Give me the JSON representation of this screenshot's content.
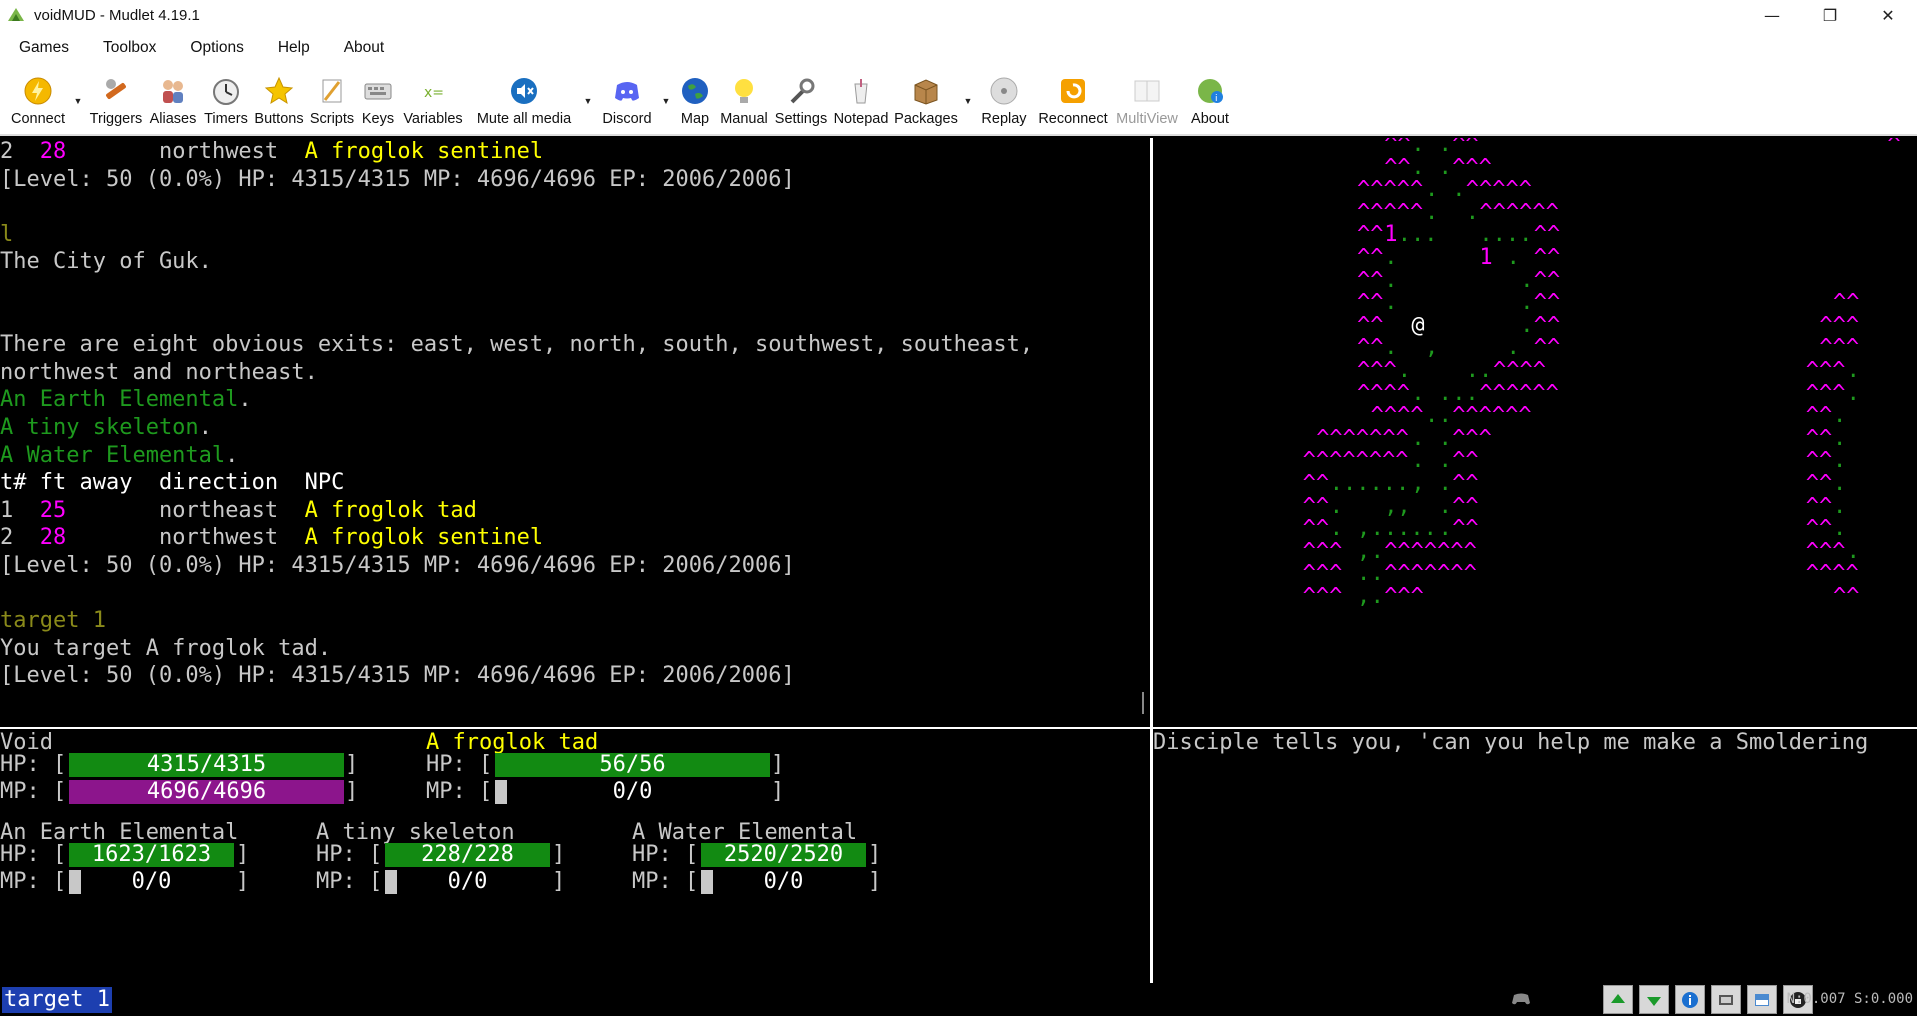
{
  "window": {
    "title": "voidMUD - Mudlet 4.19.1",
    "minimize": "—",
    "maximize": "❐",
    "close": "✕"
  },
  "menu": [
    "Games",
    "Toolbox",
    "Options",
    "Help",
    "About"
  ],
  "toolbar": [
    {
      "label": "Connect",
      "icon": "connect-icon",
      "dropdown": true
    },
    {
      "label": "Triggers",
      "icon": "triggers-icon"
    },
    {
      "label": "Aliases",
      "icon": "aliases-icon"
    },
    {
      "label": "Timers",
      "icon": "timers-icon"
    },
    {
      "label": "Buttons",
      "icon": "buttons-icon"
    },
    {
      "label": "Scripts",
      "icon": "scripts-icon"
    },
    {
      "label": "Keys",
      "icon": "keys-icon"
    },
    {
      "label": "Variables",
      "icon": "variables-icon"
    },
    {
      "label": "Mute all media",
      "icon": "mute-icon",
      "dropdown": true
    },
    {
      "label": "Discord",
      "icon": "discord-icon",
      "dropdown": true
    },
    {
      "label": "Map",
      "icon": "map-icon"
    },
    {
      "label": "Manual",
      "icon": "manual-icon"
    },
    {
      "label": "Settings",
      "icon": "settings-icon"
    },
    {
      "label": "Notepad",
      "icon": "notepad-icon"
    },
    {
      "label": "Packages",
      "icon": "packages-icon",
      "dropdown": true
    },
    {
      "label": "Replay",
      "icon": "replay-icon"
    },
    {
      "label": "Reconnect",
      "icon": "reconnect-icon"
    },
    {
      "label": "MultiView",
      "icon": "multiview-icon",
      "disabled": true
    },
    {
      "label": "About",
      "icon": "about-icon"
    }
  ],
  "console": {
    "lines": [
      {
        "segs": [
          [
            "w",
            "2  "
          ],
          [
            "m",
            "28"
          ],
          [
            "w",
            "       northwest  "
          ],
          [
            "y",
            "A froglok sentinel"
          ]
        ]
      },
      {
        "segs": [
          [
            "w",
            "[Level: 50 (0.0%) HP: 4315/4315 MP: 4696/4696 EP: 2006/2006]"
          ]
        ]
      },
      {
        "segs": [
          [
            "w",
            ""
          ]
        ]
      },
      {
        "segs": [
          [
            "ol",
            "l"
          ]
        ]
      },
      {
        "segs": [
          [
            "w",
            "The City of Guk."
          ]
        ]
      },
      {
        "segs": [
          [
            "w",
            ""
          ]
        ]
      },
      {
        "segs": [
          [
            "w",
            ""
          ]
        ]
      },
      {
        "segs": [
          [
            "w",
            "There are eight obvious exits: east, west, north, south, southwest, southeast,"
          ]
        ]
      },
      {
        "segs": [
          [
            "w",
            "northwest and northeast."
          ]
        ]
      },
      {
        "segs": [
          [
            "g",
            "An Earth Elemental"
          ],
          [
            "w",
            "."
          ]
        ]
      },
      {
        "segs": [
          [
            "g",
            "A tiny skeleton"
          ],
          [
            "w",
            "."
          ]
        ]
      },
      {
        "segs": [
          [
            "g",
            "A Water Elemental"
          ],
          [
            "w",
            "."
          ]
        ]
      },
      {
        "segs": [
          [
            "wb",
            "t# ft away  direction  NPC"
          ]
        ]
      },
      {
        "segs": [
          [
            "w",
            "1  "
          ],
          [
            "m",
            "25"
          ],
          [
            "w",
            "       northeast  "
          ],
          [
            "y",
            "A froglok tad"
          ]
        ]
      },
      {
        "segs": [
          [
            "w",
            "2  "
          ],
          [
            "m",
            "28"
          ],
          [
            "w",
            "       northwest  "
          ],
          [
            "y",
            "A froglok sentinel"
          ]
        ]
      },
      {
        "segs": [
          [
            "w",
            "[Level: 50 (0.0%) HP: 4315/4315 MP: 4696/4696 EP: 2006/2006]"
          ]
        ]
      },
      {
        "segs": [
          [
            "w",
            ""
          ]
        ]
      },
      {
        "segs": [
          [
            "ol",
            "target 1"
          ]
        ]
      },
      {
        "segs": [
          [
            "w",
            "You target A froglok tad."
          ]
        ]
      },
      {
        "segs": [
          [
            "w",
            "[Level: 50 (0.0%) HP: 4315/4315 MP: 4696/4696 EP: 2006/2006]"
          ]
        ]
      }
    ]
  },
  "map": {
    "rows": [
      [
        [
          17,
          "m",
          "^^"
        ],
        [
          19,
          "g",
          "."
        ],
        [
          20,
          "w",
          " "
        ],
        [
          21,
          "g",
          "."
        ],
        [
          22,
          "m",
          "^^"
        ],
        [
          54,
          "m",
          "^"
        ]
      ],
      [
        [
          17,
          "m",
          "^^"
        ],
        [
          19,
          "g",
          "."
        ],
        [
          21,
          "g",
          "."
        ],
        [
          22,
          "m",
          "^^^"
        ]
      ],
      [
        [
          15,
          "m",
          "^^^^^"
        ],
        [
          20,
          "g",
          "."
        ],
        [
          22,
          "g",
          "."
        ],
        [
          23,
          "m",
          "^^^^^"
        ]
      ],
      [
        [
          15,
          "m",
          "^^^^^"
        ],
        [
          20,
          "g",
          "."
        ],
        [
          23,
          "g",
          "."
        ],
        [
          24,
          "m",
          "^^^^^^"
        ]
      ],
      [
        [
          15,
          "m",
          "^^"
        ],
        [
          17,
          "m",
          "1"
        ],
        [
          18,
          "g",
          "..."
        ],
        [
          24,
          "g",
          "...."
        ],
        [
          28,
          "m",
          "^^"
        ]
      ],
      [
        [
          15,
          "m",
          "^^"
        ],
        [
          17,
          "g",
          "."
        ],
        [
          24,
          "m",
          "1"
        ],
        [
          26,
          "g",
          "."
        ],
        [
          28,
          "m",
          "^^"
        ]
      ],
      [
        [
          15,
          "m",
          "^^"
        ],
        [
          17,
          "g",
          "."
        ],
        [
          27,
          "g",
          "."
        ],
        [
          28,
          "m",
          "^^"
        ]
      ],
      [
        [
          15,
          "m",
          "^^"
        ],
        [
          17,
          "g",
          "."
        ],
        [
          27,
          "g",
          "."
        ],
        [
          28,
          "m",
          "^^"
        ],
        [
          50,
          "m",
          "^^"
        ]
      ],
      [
        [
          15,
          "m",
          "^^"
        ],
        [
          19,
          "wb",
          "@"
        ],
        [
          27,
          "g",
          "."
        ],
        [
          28,
          "m",
          "^^"
        ],
        [
          49,
          "m",
          "^^^"
        ]
      ],
      [
        [
          15,
          "m",
          "^^"
        ],
        [
          17,
          "g",
          "."
        ],
        [
          20,
          "g",
          ","
        ],
        [
          26,
          "g",
          "."
        ],
        [
          28,
          "m",
          "^^"
        ],
        [
          49,
          "m",
          "^^^"
        ]
      ],
      [
        [
          15,
          "m",
          "^^^"
        ],
        [
          18,
          "g",
          "."
        ],
        [
          23,
          "g",
          ".."
        ],
        [
          25,
          "m",
          "^^^^"
        ],
        [
          48,
          "m",
          "^^^"
        ],
        [
          51,
          "g",
          "."
        ]
      ],
      [
        [
          15,
          "m",
          "^^^^"
        ],
        [
          19,
          "g",
          "."
        ],
        [
          21,
          "g",
          "."
        ],
        [
          22,
          "g",
          ".."
        ],
        [
          24,
          "m",
          "^^^^^^"
        ],
        [
          48,
          "m",
          "^^^"
        ],
        [
          51,
          "g",
          "."
        ]
      ],
      [
        [
          16,
          "m",
          "^^^^"
        ],
        [
          20,
          "g",
          "."
        ],
        [
          21,
          "g",
          "."
        ],
        [
          22,
          "m",
          "^^^^^^"
        ],
        [
          48,
          "m",
          "^^"
        ],
        [
          50,
          "g",
          "."
        ]
      ],
      [
        [
          12,
          "m",
          "^^^^^^^"
        ],
        [
          19,
          "g",
          "."
        ],
        [
          21,
          "g",
          "."
        ],
        [
          22,
          "m",
          "^^^"
        ],
        [
          48,
          "m",
          "^^"
        ],
        [
          50,
          "g",
          "."
        ]
      ],
      [
        [
          11,
          "m",
          "^^^^^^^^"
        ],
        [
          19,
          "g",
          "."
        ],
        [
          21,
          "g",
          "."
        ],
        [
          22,
          "m",
          "^^"
        ],
        [
          48,
          "m",
          "^^"
        ],
        [
          50,
          "g",
          "."
        ]
      ],
      [
        [
          11,
          "m",
          "^^"
        ],
        [
          13,
          "g",
          "......"
        ],
        [
          19,
          "g",
          ","
        ],
        [
          21,
          "g",
          "."
        ],
        [
          22,
          "m",
          "^^"
        ],
        [
          48,
          "m",
          "^^"
        ],
        [
          50,
          "g",
          "."
        ]
      ],
      [
        [
          11,
          "m",
          "^^"
        ],
        [
          13,
          "g",
          "."
        ],
        [
          17,
          "g",
          ",,"
        ],
        [
          21,
          "g",
          "."
        ],
        [
          22,
          "m",
          "^^"
        ],
        [
          48,
          "m",
          "^^"
        ],
        [
          50,
          "g",
          "."
        ]
      ],
      [
        [
          11,
          "m",
          "^^"
        ],
        [
          13,
          "g",
          "."
        ],
        [
          15,
          "g",
          ","
        ],
        [
          16,
          "g",
          "....."
        ],
        [
          21,
          "g",
          "."
        ],
        [
          22,
          "m",
          "^^"
        ],
        [
          48,
          "m",
          "^^"
        ],
        [
          50,
          "g",
          "."
        ]
      ],
      [
        [
          11,
          "m",
          "^^^"
        ],
        [
          15,
          "g",
          ","
        ],
        [
          16,
          "g",
          "."
        ],
        [
          17,
          "m",
          "^^^^^^^"
        ],
        [
          48,
          "m",
          "^^^"
        ],
        [
          51,
          "g",
          "."
        ]
      ],
      [
        [
          11,
          "m",
          "^^^"
        ],
        [
          15,
          "g",
          "."
        ],
        [
          16,
          "g",
          "."
        ],
        [
          17,
          "m",
          "^^^^^^^"
        ],
        [
          48,
          "m",
          "^^^^"
        ]
      ],
      [
        [
          11,
          "m",
          "^^^"
        ],
        [
          15,
          "g",
          ","
        ],
        [
          16,
          "g",
          "."
        ],
        [
          17,
          "m",
          "^^^"
        ],
        [
          50,
          "m",
          "^^"
        ]
      ]
    ]
  },
  "status": {
    "player": {
      "name": "Void",
      "hp": "4315/4315",
      "mp": "4696/4696",
      "hp_frac": 1.0,
      "mp_frac": 1.0
    },
    "target": {
      "name": "A froglok tad",
      "hp": "56/56",
      "mp": "0/0",
      "hp_frac": 1.0,
      "mp_frac": 0.0
    },
    "allies": [
      {
        "name": "An Earth Elemental",
        "hp": "1623/1623",
        "mp": "0/0"
      },
      {
        "name": "A tiny skeleton",
        "hp": "228/228",
        "mp": "0/0"
      },
      {
        "name": "A Water Elemental",
        "hp": "2520/2520",
        "mp": "0/0"
      }
    ],
    "hp_label": "HP: [",
    "mp_label": "MP: [",
    "close_bracket": "]"
  },
  "chat": {
    "line": "Disciple tells you, 'can you help me make a Smoldering"
  },
  "command": {
    "text": "target 1"
  },
  "netstats": "N:0.007 S:0.000",
  "colors": {
    "green_bar": "#128a12",
    "purple_bar": "#8c158c",
    "map_mountain": "#ff00ff",
    "npc_name": "#ffff00"
  }
}
